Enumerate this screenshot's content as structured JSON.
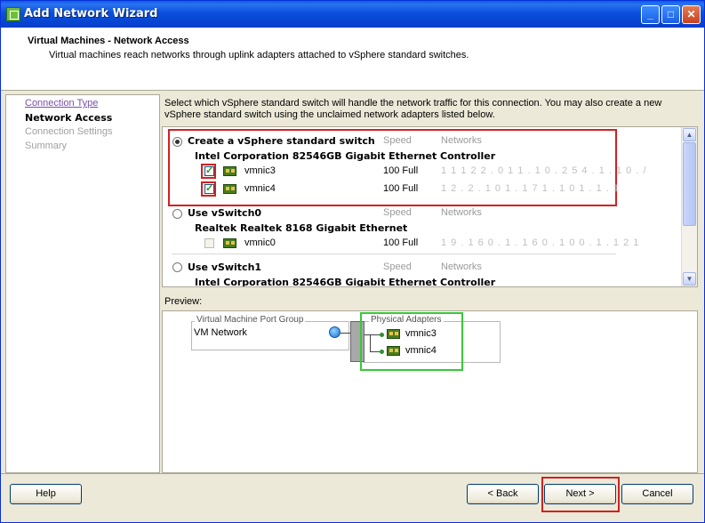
{
  "window": {
    "title": "Add Network Wizard",
    "min": "_",
    "max": "□",
    "close": "✕"
  },
  "header": {
    "title": "Virtual Machines - Network Access",
    "subtitle": "Virtual machines reach networks through uplink adapters attached to vSphere standard switches."
  },
  "nav": {
    "items": [
      {
        "label": "Connection Type",
        "state": "link"
      },
      {
        "label": "Network Access",
        "state": "current"
      },
      {
        "label": "Connection Settings",
        "state": "disabled"
      },
      {
        "label": "Summary",
        "state": "disabled"
      }
    ]
  },
  "main": {
    "intro": "Select which vSphere standard switch will handle the network traffic for this connection. You may also create a new vSphere standard switch using the unclaimed network adapters listed below.",
    "col_speed": "Speed",
    "col_networks": "Networks",
    "switches": [
      {
        "label": "Create a vSphere standard switch",
        "selected": true,
        "controller": "Intel Corporation 82546GB Gigabit Ethernet Controller",
        "nics": [
          {
            "name": "vmnic3",
            "speed": "100 Full",
            "networks": "1 1  1 2 2 . 0  1 1 . 1 0 . 2 5 4 . 1 . 1 0 . /",
            "checked": true
          },
          {
            "name": "vmnic4",
            "speed": "100 Full",
            "networks": "1 2 . 2 . 1 0  1 . 1 7 1 . 1 0 1 . 1 . 1",
            "checked": true
          }
        ]
      },
      {
        "label": "Use vSwitch0",
        "selected": false,
        "controller": "Realtek Realtek 8168 Gigabit Ethernet",
        "nics": [
          {
            "name": "vmnic0",
            "speed": "100 Full",
            "networks": "1 9 . 1 6 0 . 1 . 1 6 0 . 1 0 0 . 1 . 1 2 1",
            "checked": false
          }
        ]
      },
      {
        "label": "Use vSwitch1",
        "selected": false,
        "controller": "Intel Corporation 82546GB Gigabit Ethernet Controller",
        "nics": []
      }
    ]
  },
  "preview": {
    "label": "Preview:",
    "port_group_legend": "Virtual Machine Port Group",
    "port_group_name": "VM Network",
    "adapters_legend": "Physical Adapters",
    "adapters": [
      "vmnic3",
      "vmnic4"
    ]
  },
  "buttons": {
    "help": "Help",
    "back": "< Back",
    "next": "Next >",
    "cancel": "Cancel"
  }
}
